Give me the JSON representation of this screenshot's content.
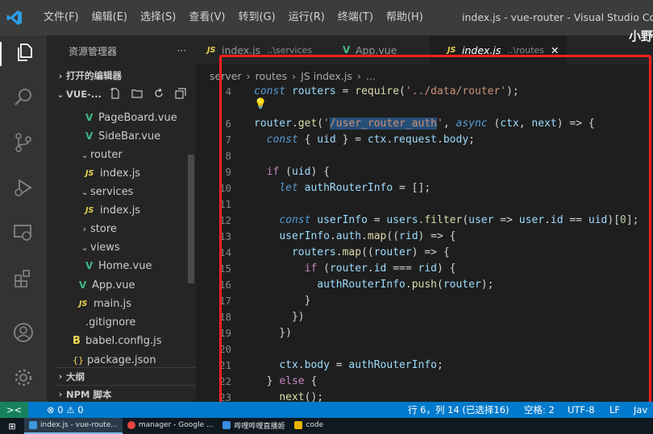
{
  "menubar": {
    "items": [
      "文件(F)",
      "编辑(E)",
      "选择(S)",
      "查看(V)",
      "转到(G)",
      "运行(R)",
      "终端(T)",
      "帮助(H)"
    ],
    "window_title": "index.js - vue-router - Visual Studio Code",
    "overlay_text": "小野"
  },
  "sidebar": {
    "title": "资源管理器",
    "more": "···",
    "open_editors": "打开的编辑器",
    "project": "VUE-...",
    "tree": [
      {
        "name": "PageBoard.vue",
        "type": "vue"
      },
      {
        "name": "SideBar.vue",
        "type": "vue"
      },
      {
        "name": "router",
        "type": "folder-open"
      },
      {
        "name": "index.js",
        "type": "js"
      },
      {
        "name": "services",
        "type": "folder-open"
      },
      {
        "name": "index.js",
        "type": "js"
      },
      {
        "name": "store",
        "type": "folder-closed"
      },
      {
        "name": "views",
        "type": "folder-open"
      },
      {
        "name": "Home.vue",
        "type": "vue"
      },
      {
        "name": "App.vue",
        "type": "vue"
      },
      {
        "name": "main.js",
        "type": "js"
      },
      {
        "name": ".gitignore",
        "type": "git"
      },
      {
        "name": "babel.config.js",
        "type": "babel"
      },
      {
        "name": "package.json",
        "type": "json"
      }
    ],
    "outline": "大纲",
    "npm": "NPM 脚本"
  },
  "tabs": [
    {
      "icon": "JS",
      "label": "index.js",
      "sub": "..\\services"
    },
    {
      "icon": "V",
      "label": "App.vue",
      "sub": ""
    },
    {
      "icon": "JS",
      "label": "index.js",
      "sub": "..\\routes",
      "close": "✕"
    }
  ],
  "breadcrumb": [
    "server",
    "routes",
    "JS index.js",
    "..."
  ],
  "editor": {
    "lines": [
      {
        "n": "4",
        "code": "const routers = require('../data/router');"
      },
      {
        "n": "",
        "code": ""
      },
      {
        "n": "6",
        "code": "router.get('/user_router_auth', async (ctx, next) => {"
      },
      {
        "n": "7",
        "code": "  const { uid } = ctx.request.body;"
      },
      {
        "n": "8",
        "code": ""
      },
      {
        "n": "9",
        "code": "  if (uid) {"
      },
      {
        "n": "10",
        "code": "    let authRouterInfo = [];"
      },
      {
        "n": "11",
        "code": ""
      },
      {
        "n": "12",
        "code": "    const userInfo = users.filter(user => user.id == uid)[0];"
      },
      {
        "n": "13",
        "code": "    userInfo.auth.map((rid) => {"
      },
      {
        "n": "14",
        "code": "      routers.map((router) => {"
      },
      {
        "n": "15",
        "code": "        if (router.id === rid) {"
      },
      {
        "n": "16",
        "code": "          authRouterInfo.push(router);"
      },
      {
        "n": "17",
        "code": "        }"
      },
      {
        "n": "18",
        "code": "      })"
      },
      {
        "n": "19",
        "code": "    })"
      },
      {
        "n": "20",
        "code": ""
      },
      {
        "n": "21",
        "code": "    ctx.body = authRouterInfo;"
      },
      {
        "n": "22",
        "code": "  } else {"
      },
      {
        "n": "23",
        "code": "    next();"
      }
    ]
  },
  "statusbar": {
    "remote": "><",
    "errors": "⊗ 0 ⚠ 0",
    "position": "行 6，列 14 (已选择16)",
    "spaces": "空格: 2",
    "encoding": "UTF-8",
    "eol": "LF",
    "lang": "Jav"
  },
  "taskbar": {
    "items": [
      {
        "label": "index.js - vue-route...",
        "color": "#3c99dc"
      },
      {
        "label": "manager - Google ...",
        "color": "#e8453c"
      },
      {
        "label": "哔哩哔哩直播姬",
        "color": "#3a8ee6"
      },
      {
        "label": "code",
        "color": "#e6b400"
      }
    ]
  }
}
